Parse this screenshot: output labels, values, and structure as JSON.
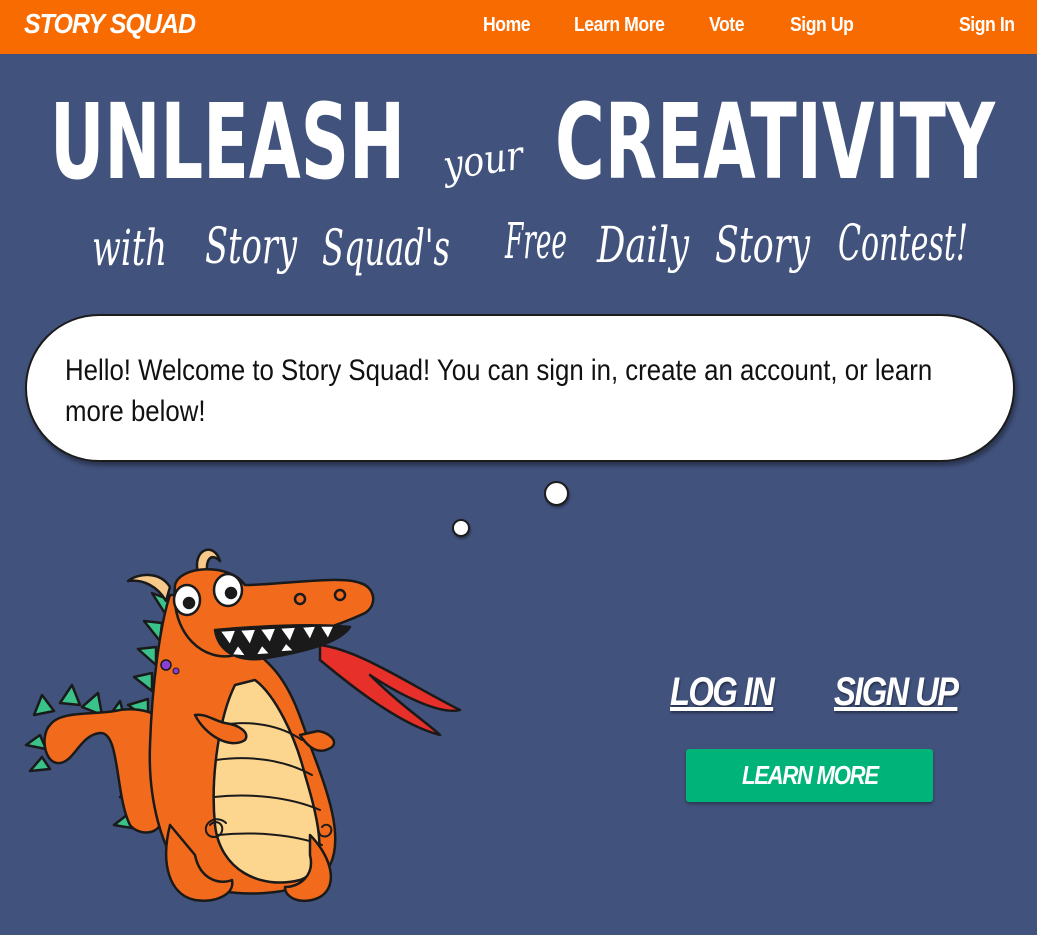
{
  "nav": {
    "brand": "STORY SQUAD",
    "links": [
      "Home",
      "Learn More",
      "Vote",
      "Sign Up"
    ],
    "sign_in": "Sign In"
  },
  "hero": {
    "word1": "UNLEASH",
    "word2": "your",
    "word3": "CREATIVITY",
    "subtitle_parts": [
      "with",
      "Story",
      "Squad's",
      "Free",
      "Daily",
      "Story",
      "Contest!"
    ]
  },
  "bubble": {
    "message": "Hello! Welcome to Story Squad! You can sign in, create an account, or learn more below!"
  },
  "actions": {
    "log_in": "LOG IN",
    "sign_up": "SIGN UP",
    "learn_more": "LEARN MORE"
  },
  "colors": {
    "background": "#41527d",
    "nav": "#f86b00",
    "button": "#00b378",
    "dragon": "#f26b1d"
  },
  "icons": {
    "mascot": "dragon-mascot-illustration"
  }
}
